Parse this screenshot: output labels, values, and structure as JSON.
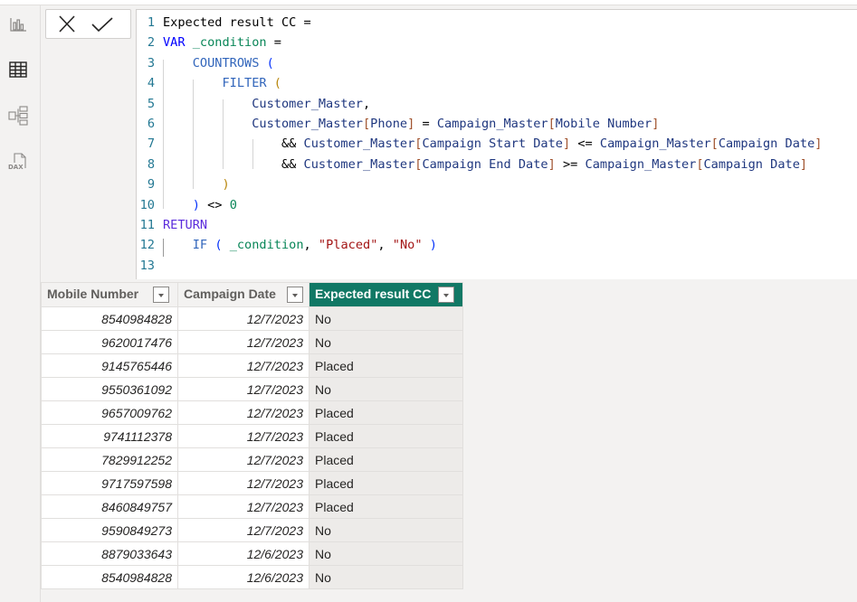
{
  "sidebar": {
    "items": [
      {
        "icon": "report-view-icon"
      },
      {
        "icon": "table-view-icon",
        "active": true
      },
      {
        "icon": "model-view-icon"
      },
      {
        "icon": "dax-query-view-icon",
        "label": "DAX"
      }
    ]
  },
  "formula_bar": {
    "cancel_icon": "x-icon",
    "commit_icon": "checkmark-icon",
    "lines": [
      {
        "n": "1",
        "tokens": [
          [
            "plain",
            "Expected result CC ="
          ]
        ]
      },
      {
        "n": "2",
        "tokens": [
          [
            "kw",
            "VAR"
          ],
          [
            "plain",
            " "
          ],
          [
            "var",
            "_condition"
          ],
          [
            "plain",
            " ="
          ]
        ]
      },
      {
        "n": "3",
        "tokens": [
          [
            "plain",
            "    "
          ],
          [
            "fn",
            "COUNTROWS"
          ],
          [
            "plain",
            " "
          ],
          [
            "p1",
            "("
          ]
        ]
      },
      {
        "n": "4",
        "tokens": [
          [
            "plain",
            "        "
          ],
          [
            "fn",
            "FILTER"
          ],
          [
            "plain",
            " "
          ],
          [
            "p2",
            "("
          ]
        ]
      },
      {
        "n": "5",
        "tokens": [
          [
            "plain",
            "            "
          ],
          [
            "tbl",
            "Customer_Master"
          ],
          [
            "plain",
            ","
          ]
        ]
      },
      {
        "n": "6",
        "tokens": [
          [
            "plain",
            "            "
          ],
          [
            "tbl",
            "Customer_Master"
          ],
          [
            "br",
            "["
          ],
          [
            "col",
            "Phone"
          ],
          [
            "br",
            "]"
          ],
          [
            "op",
            " = "
          ],
          [
            "tbl",
            "Campaign_Master"
          ],
          [
            "br",
            "["
          ],
          [
            "col",
            "Mobile Number"
          ],
          [
            "br",
            "]"
          ]
        ]
      },
      {
        "n": "7",
        "tokens": [
          [
            "plain",
            "                "
          ],
          [
            "op",
            "&& "
          ],
          [
            "tbl",
            "Customer_Master"
          ],
          [
            "br",
            "["
          ],
          [
            "col",
            "Campaign Start Date"
          ],
          [
            "br",
            "]"
          ],
          [
            "op",
            " <= "
          ],
          [
            "tbl",
            "Campaign_Master"
          ],
          [
            "br",
            "["
          ],
          [
            "col",
            "Campaign Date"
          ],
          [
            "br",
            "]"
          ]
        ]
      },
      {
        "n": "8",
        "tokens": [
          [
            "plain",
            "                "
          ],
          [
            "op",
            "&& "
          ],
          [
            "tbl",
            "Customer_Master"
          ],
          [
            "br",
            "["
          ],
          [
            "col",
            "Campaign End Date"
          ],
          [
            "br",
            "]"
          ],
          [
            "op",
            " >= "
          ],
          [
            "tbl",
            "Campaign_Master"
          ],
          [
            "br",
            "["
          ],
          [
            "col",
            "Campaign Date"
          ],
          [
            "br",
            "]"
          ]
        ]
      },
      {
        "n": "9",
        "tokens": [
          [
            "plain",
            "        "
          ],
          [
            "p2",
            ")"
          ]
        ]
      },
      {
        "n": "10",
        "tokens": [
          [
            "plain",
            "    "
          ],
          [
            "p1",
            ")"
          ],
          [
            "op",
            " <> "
          ],
          [
            "num",
            "0"
          ]
        ]
      },
      {
        "n": "11",
        "tokens": [
          [
            "ret",
            "RETURN"
          ]
        ]
      },
      {
        "n": "12",
        "tokens": [
          [
            "plain",
            "    "
          ],
          [
            "fn",
            "IF"
          ],
          [
            "plain",
            " "
          ],
          [
            "p1",
            "("
          ],
          [
            "plain",
            " "
          ],
          [
            "var",
            "_condition"
          ],
          [
            "plain",
            ", "
          ],
          [
            "str",
            "\"Placed\""
          ],
          [
            "plain",
            ", "
          ],
          [
            "str",
            "\"No\""
          ],
          [
            "plain",
            " "
          ],
          [
            "p1",
            ")"
          ]
        ]
      },
      {
        "n": "13",
        "tokens": []
      }
    ]
  },
  "table": {
    "columns": [
      "Mobile Number",
      "Campaign Date",
      "Expected result CC"
    ],
    "active_column": "Expected result CC",
    "rows": [
      [
        "8540984828",
        "12/7/2023",
        "No"
      ],
      [
        "9620017476",
        "12/7/2023",
        "No"
      ],
      [
        "9145765446",
        "12/7/2023",
        "Placed"
      ],
      [
        "9550361092",
        "12/7/2023",
        "No"
      ],
      [
        "9657009762",
        "12/7/2023",
        "Placed"
      ],
      [
        "9741112378",
        "12/7/2023",
        "Placed"
      ],
      [
        "7829912252",
        "12/7/2023",
        "Placed"
      ],
      [
        "9717597598",
        "12/7/2023",
        "Placed"
      ],
      [
        "8460849757",
        "12/7/2023",
        "Placed"
      ],
      [
        "9590849273",
        "12/7/2023",
        "No"
      ],
      [
        "8879033643",
        "12/6/2023",
        "No"
      ],
      [
        "8540984828",
        "12/6/2023",
        "No"
      ]
    ]
  },
  "colors": {
    "active_header": "#117865",
    "line_numbers": "#237893"
  }
}
